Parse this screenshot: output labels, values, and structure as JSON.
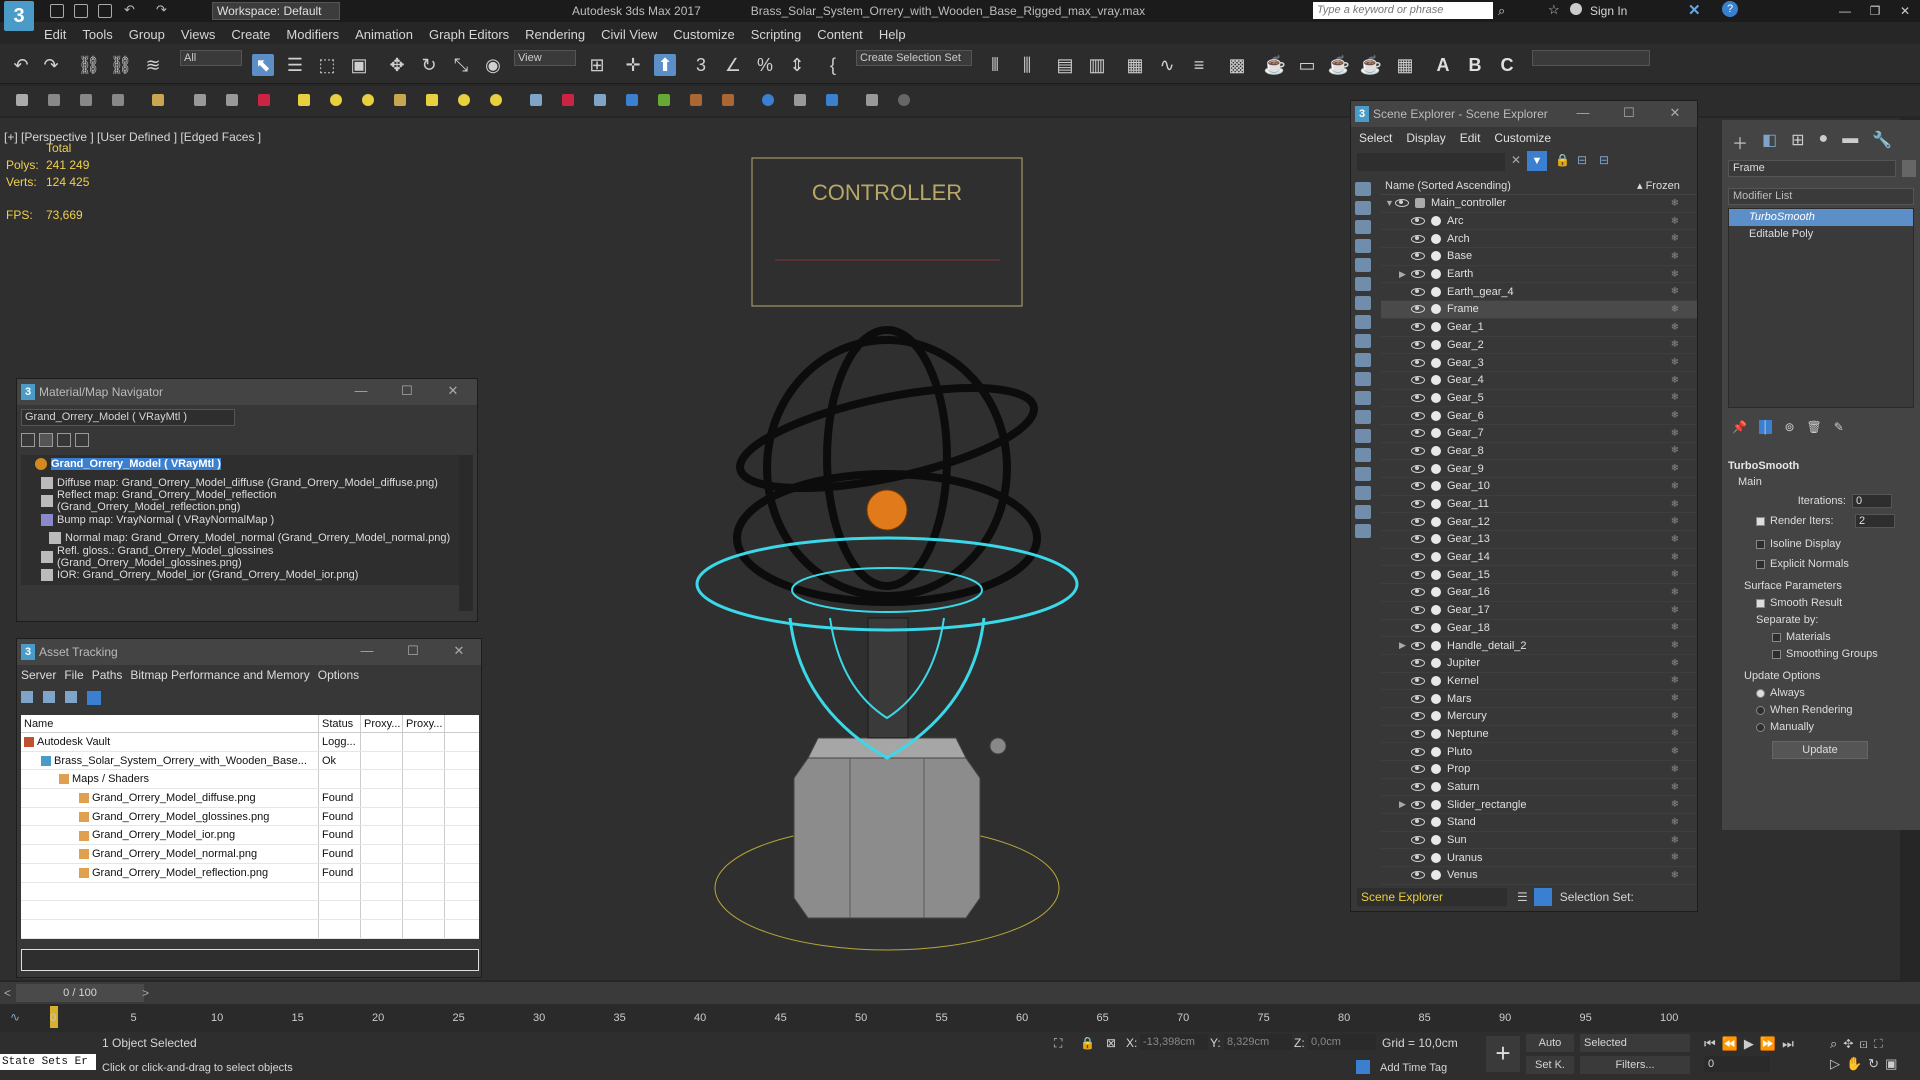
{
  "titlebar": {
    "workspace": "Workspace: Default",
    "app_title": "Autodesk 3ds Max 2017",
    "file_name": "Brass_Solar_System_Orrery_with_Wooden_Base_Rigged_max_vray.max",
    "search_placeholder": "Type a keyword or phrase",
    "sign_in": "Sign In",
    "logo": "3"
  },
  "menu": [
    "Edit",
    "Tools",
    "Group",
    "Views",
    "Create",
    "Modifiers",
    "Animation",
    "Graph Editors",
    "Rendering",
    "Civil View",
    "Customize",
    "Scripting",
    "Content",
    "Help"
  ],
  "toolbar": {
    "filter_all": "All",
    "view_dropdown": "View",
    "selection_set": "Create Selection Set"
  },
  "viewport": {
    "label": "[+] [Perspective ] [User Defined ] [Edged Faces ]",
    "total": "Total",
    "polys_label": "Polys:",
    "polys": "241 249",
    "verts_label": "Verts:",
    "verts": "124 425",
    "fps_label": "FPS:",
    "fps": "73,669",
    "controller_text": "CONTROLLER"
  },
  "scene_explorer": {
    "title": "Scene Explorer - Scene Explorer",
    "menu": [
      "Select",
      "Display",
      "Edit",
      "Customize"
    ],
    "col_name": "Name (Sorted Ascending)",
    "col_frozen": "▴ Frozen",
    "root": "Main_controller",
    "items": [
      "Arc",
      "Arch",
      "Base",
      "Earth",
      "Earth_gear_4",
      "Frame",
      "Gear_1",
      "Gear_2",
      "Gear_3",
      "Gear_4",
      "Gear_5",
      "Gear_6",
      "Gear_7",
      "Gear_8",
      "Gear_9",
      "Gear_10",
      "Gear_11",
      "Gear_12",
      "Gear_13",
      "Gear_14",
      "Gear_15",
      "Gear_16",
      "Gear_17",
      "Gear_18",
      "Handle_detail_2",
      "Jupiter",
      "Kernel",
      "Mars",
      "Mercury",
      "Neptune",
      "Pluto",
      "Prop",
      "Saturn",
      "Slider_rectangle",
      "Stand",
      "Sun",
      "Uranus",
      "Venus"
    ],
    "selected": "Frame",
    "footer_label": "Scene Explorer",
    "selection_set_label": "Selection Set:"
  },
  "command_panel": {
    "object_name": "Frame",
    "modifier_list": "Modifier List",
    "stack": [
      "TurboSmooth",
      "Editable Poly"
    ],
    "rollout_title": "TurboSmooth",
    "main": "Main",
    "iterations_label": "Iterations:",
    "iterations": "0",
    "render_iters_label": "Render Iters:",
    "render_iters": "2",
    "isoline": "Isoline Display",
    "explicit_normals": "Explicit Normals",
    "surface_params": "Surface Parameters",
    "smooth_result": "Smooth Result",
    "separate_by": "Separate by:",
    "materials": "Materials",
    "smoothing_groups": "Smoothing Groups",
    "update_options": "Update Options",
    "always": "Always",
    "when_rendering": "When Rendering",
    "manually": "Manually",
    "update_btn": "Update"
  },
  "material_nav": {
    "title": "Material/Map Navigator",
    "field": "Grand_Orrery_Model  ( VRayMtl )",
    "items": [
      "Grand_Orrery_Model  ( VRayMtl )",
      "Diffuse map: Grand_Orrery_Model_diffuse (Grand_Orrery_Model_diffuse.png)",
      "Reflect map: Grand_Orrery_Model_reflection (Grand_Orrery_Model_reflection.png)",
      "Bump map: VrayNormal  ( VRayNormalMap )",
      "Normal map: Grand_Orrery_Model_normal (Grand_Orrery_Model_normal.png)",
      "Refl. gloss.: Grand_Orrery_Model_glossines (Grand_Orrery_Model_glossines.png)",
      "IOR: Grand_Orrery_Model_ior (Grand_Orrery_Model_ior.png)"
    ]
  },
  "asset_tracking": {
    "title": "Asset Tracking",
    "menu": [
      "Server",
      "File",
      "Paths",
      "Bitmap Performance and Memory",
      "Options"
    ],
    "columns": [
      "Name",
      "Status",
      "Proxy...",
      "Proxy..."
    ],
    "rows": [
      {
        "name": "Autodesk Vault",
        "status": "Logg..."
      },
      {
        "name": "Brass_Solar_System_Orrery_with_Wooden_Base...",
        "status": "Ok"
      },
      {
        "name": "Maps / Shaders",
        "status": ""
      },
      {
        "name": "Grand_Orrery_Model_diffuse.png",
        "status": "Found"
      },
      {
        "name": "Grand_Orrery_Model_glossines.png",
        "status": "Found"
      },
      {
        "name": "Grand_Orrery_Model_ior.png",
        "status": "Found"
      },
      {
        "name": "Grand_Orrery_Model_normal.png",
        "status": "Found"
      },
      {
        "name": "Grand_Orrery_Model_reflection.png",
        "status": "Found"
      }
    ]
  },
  "timeline": {
    "frame": "0 / 100",
    "ticks": [
      "0",
      "5",
      "10",
      "15",
      "20",
      "25",
      "30",
      "35",
      "40",
      "45",
      "50",
      "55",
      "60",
      "65",
      "70",
      "75",
      "80",
      "85",
      "90",
      "95",
      "100"
    ]
  },
  "status": {
    "state_sets": "State Sets Er",
    "selected": "1 Object Selected",
    "prompt": "Click or click-and-drag to select objects",
    "x_label": "X:",
    "x": "-13,398cm",
    "y_label": "Y:",
    "y": "8,329cm",
    "z_label": "Z:",
    "z": "0,0cm",
    "grid": "Grid = 10,0cm",
    "add_time_tag": "Add Time Tag",
    "auto": "Auto",
    "set_k": "Set K.",
    "selected_dd": "Selected",
    "filters": "Filters...",
    "frame_spin": "0"
  }
}
